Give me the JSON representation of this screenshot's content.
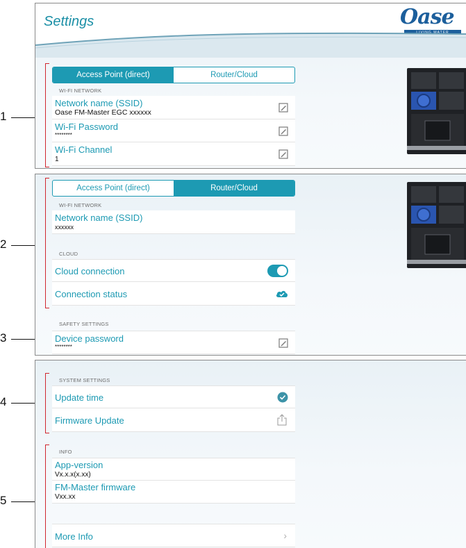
{
  "header": {
    "title": "Settings",
    "logo_text": "Oase",
    "logo_tagline": "LIVING WATER"
  },
  "mode_toggle": {
    "access_point_label": "Access Point (direct)",
    "router_label": "Router/Cloud"
  },
  "panel1": {
    "section_wifi": "WI-FI NETWORK",
    "ssid_label": "Network name (SSID)",
    "ssid_value": "Oase FM-Master EGC xxxxxx",
    "password_label": "Wi-Fi Password",
    "password_value": "********",
    "channel_label": "Wi-Fi Channel",
    "channel_value": "1"
  },
  "panel2": {
    "section_wifi": "WI-FI NETWORK",
    "ssid_label": "Network name (SSID)",
    "ssid_value": "xxxxxx",
    "section_cloud": "CLOUD",
    "cloud_connection_label": "Cloud connection",
    "cloud_connection_on": true,
    "connection_status_label": "Connection status",
    "section_safety": "SAFETY SETTINGS",
    "device_password_label": "Device password",
    "device_password_value": "********"
  },
  "panel3": {
    "section_system": "SYSTEM SETTINGS",
    "update_time_label": "Update time",
    "firmware_update_label": "Firmware Update",
    "section_info": "INFO",
    "app_version_label": "App-version",
    "app_version_value": "Vx.x.x(x.xx)",
    "fm_firmware_label": "FM-Master firmware",
    "fm_firmware_value": "Vxx.xx",
    "more_info_label": "More Info"
  },
  "callouts": [
    "1",
    "2",
    "3",
    "4",
    "5"
  ],
  "colors": {
    "accent": "#1d9ab3",
    "callout_bracket": "#d0262e",
    "brand": "#1c5f9c"
  }
}
